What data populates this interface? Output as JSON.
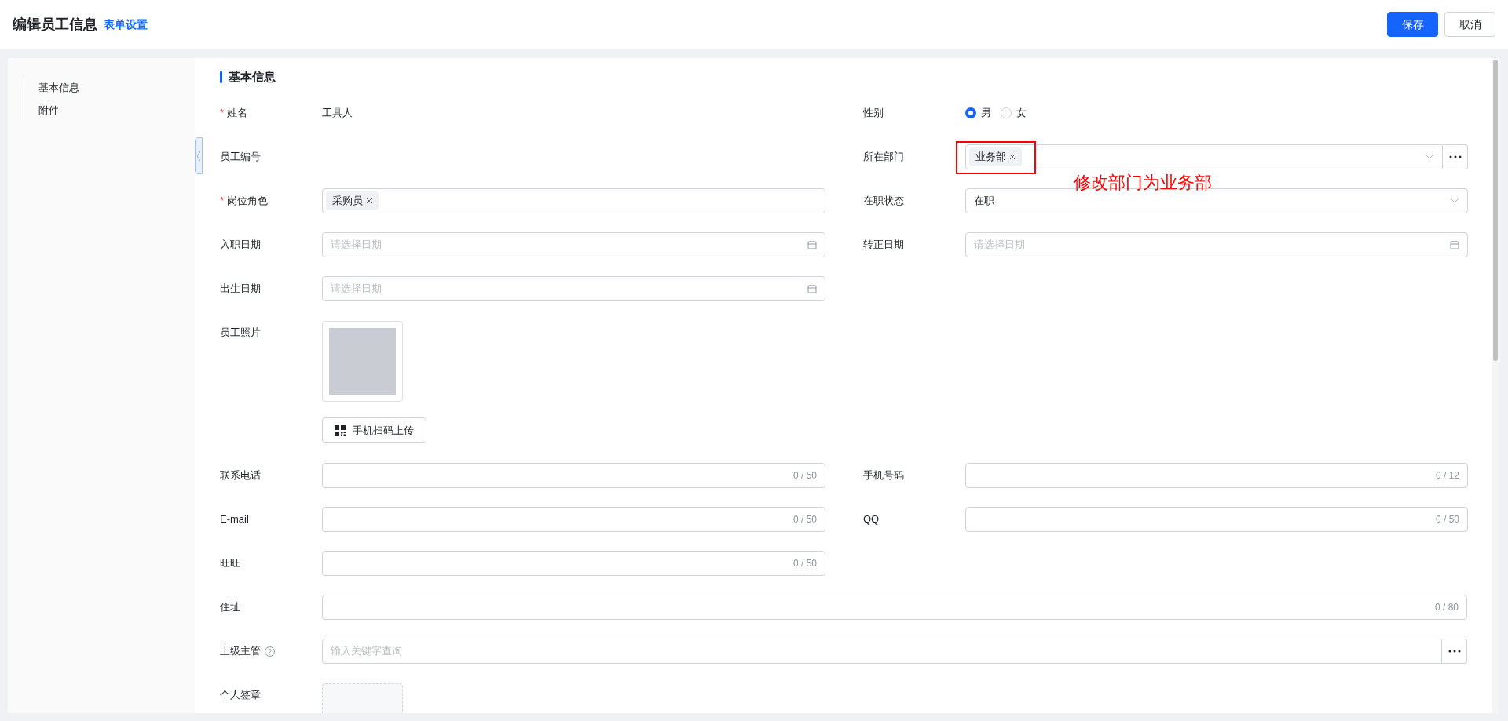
{
  "header": {
    "title": "编辑员工信息",
    "link": "表单设置",
    "buttons": [
      {
        "label": "保存",
        "kind": "primary"
      },
      {
        "label": "取消",
        "kind": "default"
      }
    ]
  },
  "sidebar": {
    "items": [
      {
        "label": "基本信息"
      },
      {
        "label": "附件"
      }
    ]
  },
  "section": {
    "title": "基本信息"
  },
  "rows": [
    {
      "fields": [
        {
          "label": "姓名",
          "required_mark": "*",
          "kind": "text",
          "value": "工具人"
        },
        {
          "label": "性别",
          "kind": "radio",
          "options": [
            {
              "label": "男",
              "selected": true
            },
            {
              "label": "女",
              "selected": false
            }
          ]
        }
      ]
    },
    {
      "fields": [
        {
          "label": "员工编号",
          "kind": "text"
        },
        {
          "label": "所在部门",
          "kind": "tags-more",
          "tags": [
            "业务部"
          ]
        }
      ]
    },
    {
      "fields": [
        {
          "label": "岗位角色",
          "required_mark": "*",
          "kind": "tags",
          "tags": [
            "采购员"
          ]
        },
        {
          "label": "在职状态",
          "kind": "select",
          "value": "在职"
        }
      ]
    },
    {
      "fields": [
        {
          "label": "入职日期",
          "kind": "date",
          "placeholder": "请选择日期"
        },
        {
          "label": "转正日期",
          "kind": "date",
          "placeholder": "请选择日期"
        }
      ]
    },
    {
      "fields": [
        {
          "label": "出生日期",
          "kind": "date",
          "placeholder": "请选择日期"
        }
      ]
    },
    {
      "fields": [
        {
          "label": "员工照片",
          "kind": "photo",
          "button": "手机扫码上传"
        }
      ]
    },
    {
      "fields": [
        {
          "label": "联系电话",
          "kind": "counter",
          "counter": "0 / 50"
        },
        {
          "label": "手机号码",
          "kind": "counter",
          "counter": "0 / 12"
        }
      ]
    },
    {
      "fields": [
        {
          "label": "E-mail",
          "kind": "counter",
          "counter": "0 / 50"
        },
        {
          "label": "QQ",
          "kind": "counter",
          "counter": "0 / 50"
        }
      ]
    },
    {
      "fields": [
        {
          "label": "旺旺",
          "kind": "counter",
          "counter": "0 / 50"
        }
      ]
    },
    {
      "fields": [
        {
          "label": "住址",
          "kind": "counter",
          "counter": "0 / 80",
          "wide": true
        }
      ]
    },
    {
      "fields": [
        {
          "label": "上级主管",
          "help": true,
          "kind": "search-more",
          "placeholder": "输入关键字查询",
          "wide": true
        }
      ]
    },
    {
      "fields": [
        {
          "label": "个人签章",
          "kind": "signature",
          "wide": true
        }
      ]
    }
  ],
  "annotation": {
    "text": "修改部门为业务部"
  }
}
